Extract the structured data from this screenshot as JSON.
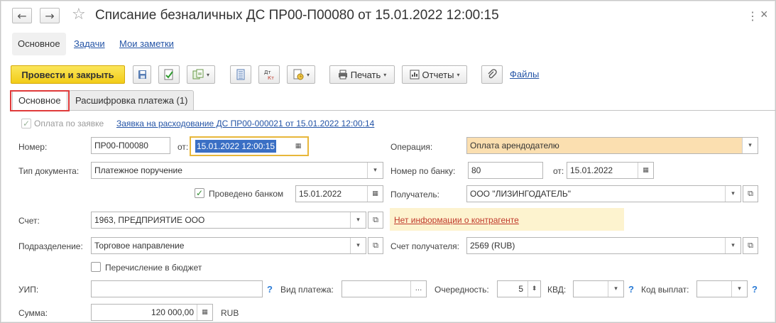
{
  "window": {
    "title": "Списание безналичных ДС ПР00-П00080 от 15.01.2022 12:00:15",
    "back_glyph": "←",
    "forward_glyph": "→",
    "star_glyph": "☆",
    "more_glyph": "⋮",
    "close_glyph": "×"
  },
  "nav": {
    "main": "Основное",
    "tasks": "Задачи",
    "notes": "Мои заметки"
  },
  "toolbar": {
    "post_close": "Провести и закрыть",
    "print": "Печать",
    "reports": "Отчеты",
    "files": "Файлы"
  },
  "tabs": {
    "main": "Основное",
    "payment_breakdown": "Расшифровка платежа (1)"
  },
  "form": {
    "pay_by_request_label": "Оплата по заявке",
    "request_link": "Заявка на расходование ДС ПР00-000021 от 15.01.2022 12:00:14",
    "number_label": "Номер:",
    "number_value": "ПР00-П00080",
    "date_from_label": "от:",
    "date_value": "15.01.2022 12:00:15",
    "operation_label": "Операция:",
    "operation_value": "Оплата арендодателю",
    "doc_type_label": "Тип документа:",
    "doc_type_value": "Платежное поручение",
    "bank_number_label": "Номер по банку:",
    "bank_number_value": "80",
    "bank_date_label": "от:",
    "bank_date_value": "15.01.2022",
    "processed_by_bank_label": "Проведено банком",
    "processed_date_value": "15.01.2022",
    "recipient_label": "Получатель:",
    "recipient_value": "ООО \"ЛИЗИНГОДАТЕЛЬ\"",
    "account_label": "Счет:",
    "account_value": "1963, ПРЕДПРИЯТИЕ ООО",
    "counterparty_warning": "Нет информации о контрагенте",
    "division_label": "Подразделение:",
    "division_value": "Торговое направление",
    "recipient_account_label": "Счет получателя:",
    "recipient_account_value": "2569 (RUB)",
    "budget_transfer_label": "Перечисление в бюджет",
    "uip_label": "УИП:",
    "uip_value": "",
    "payment_type_label": "Вид платежа:",
    "payment_type_value": "",
    "priority_label": "Очередность:",
    "priority_value": "5",
    "kvd_label": "КВД:",
    "kvd_value": "",
    "payout_code_label": "Код выплат:",
    "payout_code_value": "",
    "amount_label": "Сумма:",
    "amount_value": "120 000,00",
    "currency": "RUB",
    "help_glyph": "?",
    "check_glyph": "✓",
    "dropdown_glyph": "▾",
    "open_glyph": "⧉",
    "calendar_glyph": "▦",
    "ellipsis_glyph": "...",
    "spin_glyph": "⬍"
  },
  "colors": {
    "accent_yellow": "#f5d531",
    "link_blue": "#2454a6",
    "warning_bg": "#fdf3cf",
    "warning_text": "#c0392b",
    "operation_bg": "#fbdfb0",
    "date_highlight": "#3a6fc4",
    "red_annotation": "#e03a3a"
  }
}
